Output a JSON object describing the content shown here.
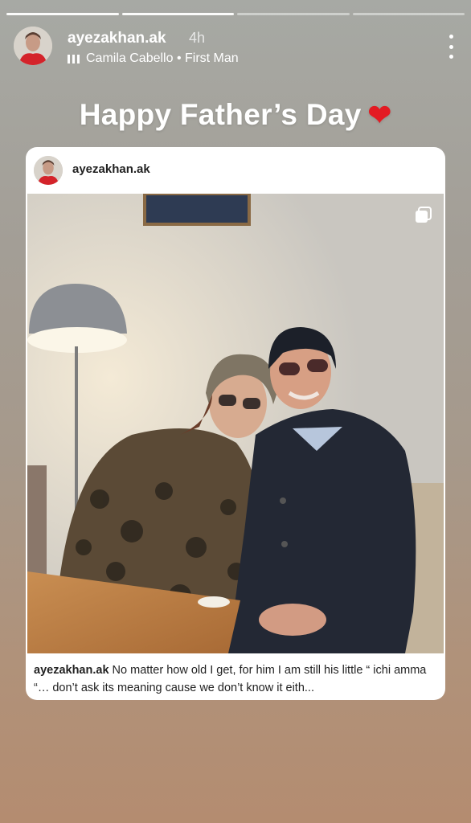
{
  "story": {
    "progress_segments": 4,
    "progress_completed": 2
  },
  "header": {
    "username": "ayezakhan.ak",
    "time": "4h",
    "music_label": "Camila Cabello • First Man"
  },
  "headline": {
    "text": "Happy Father’s Day",
    "emoji": "❤️"
  },
  "post": {
    "username": "ayezakhan.ak",
    "caption_username": "ayezakhan.ak",
    "caption_text": "No matter how old I get, for him I am still his little “ ichi amma “… don’t ask its meaning cause we don’t know it eith..."
  }
}
